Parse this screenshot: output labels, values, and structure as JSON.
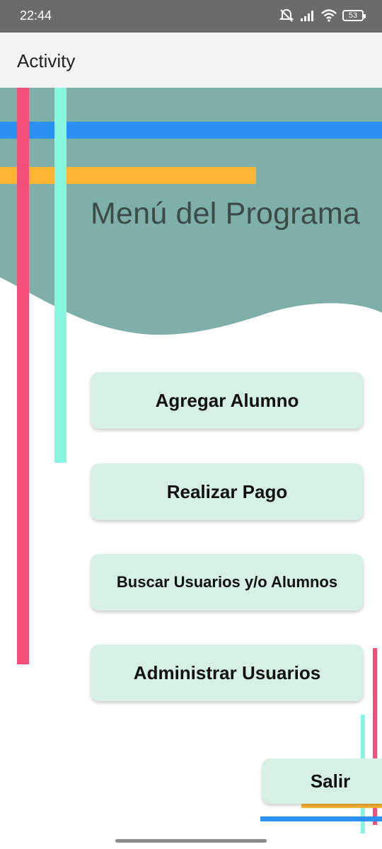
{
  "status_bar": {
    "time": "22:44",
    "battery": "53",
    "icons": [
      "mute-icon",
      "signal-icon",
      "wifi-icon",
      "battery-icon"
    ]
  },
  "app_bar": {
    "title": "Activity"
  },
  "main": {
    "title": "Menú del Programa",
    "buttons": {
      "agregar_alumno": "Agregar Alumno",
      "realizar_pago": "Realizar Pago",
      "buscar": "Buscar Usuarios y/o Alumnos",
      "administrar": "Administrar Usuarios",
      "salir": "Salir"
    }
  },
  "colors": {
    "header_bg": "#7fafa9",
    "button_bg": "#d6f1e3",
    "stripe_pink": "#f44f78",
    "stripe_mint": "#86f7de",
    "stripe_blue": "#2a90f1",
    "stripe_orange": "#fbb533"
  }
}
